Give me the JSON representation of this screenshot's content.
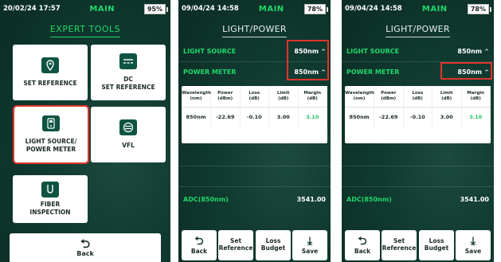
{
  "screen1": {
    "status": {
      "datetime": "20/02/24 17:57",
      "mode": "MAIN",
      "battery": "95%"
    },
    "title": "EXPERT TOOLS",
    "tiles": [
      {
        "label": "SET REFERENCE"
      },
      {
        "label": "DC\nSET REFERENCE"
      },
      {
        "label": "LIGHT SOURCE/\nPOWER METER"
      },
      {
        "label": "VFL"
      },
      {
        "label": "FIBER\nINSPECTION"
      }
    ],
    "back": "Back"
  },
  "screen2": {
    "status": {
      "datetime": "09/04/24 14:58",
      "mode": "MAIN",
      "battery": "78%"
    },
    "title": "LIGHT/POWER",
    "light_source": {
      "label": "LIGHT SOURCE",
      "value": "850nm"
    },
    "power_meter": {
      "label": "POWER METER",
      "value": "850nm"
    },
    "table": {
      "headers": [
        "Wavelength\n(nm)",
        "Power\n(dBm)",
        "Loss\n(dB)",
        "Limit\n(dB)",
        "Margin\n(dB)"
      ],
      "row": [
        "850nm",
        "-22.69",
        "-0.10",
        "3.00",
        "3.10"
      ]
    },
    "adc": {
      "label": "ADC(850nm)",
      "value": "3541.00"
    },
    "buttons": {
      "back": "Back",
      "set_reference": "Set\nReference",
      "loss_budget": "Loss\nBudget",
      "save": "Save"
    }
  },
  "screen3": {
    "status": {
      "datetime": "09/04/24 14:58",
      "mode": "MAIN",
      "battery": "78%"
    },
    "title": "LIGHT/POWER",
    "light_source": {
      "label": "LIGHT SOURCE",
      "value": "850nm"
    },
    "power_meter": {
      "label": "POWER METER",
      "value": "850nm"
    },
    "table": {
      "headers": [
        "Wavelength\n(nm)",
        "Power\n(dBm)",
        "Loss\n(dB)",
        "Limit\n(dB)",
        "Margin\n(dB)"
      ],
      "row": [
        "850nm",
        "-22.69",
        "-0.10",
        "3.00",
        "3.10"
      ]
    },
    "adc": {
      "label": "ADC(850nm)",
      "value": "3541.00"
    },
    "buttons": {
      "back": "Back",
      "set_reference": "Set\nReference",
      "loss_budget": "Loss\nBudget",
      "save": "Save"
    }
  },
  "colors": {
    "accent_green": "#22d66a",
    "highlight_red": "#e0342b",
    "panel_dark": "#0f3a30"
  }
}
